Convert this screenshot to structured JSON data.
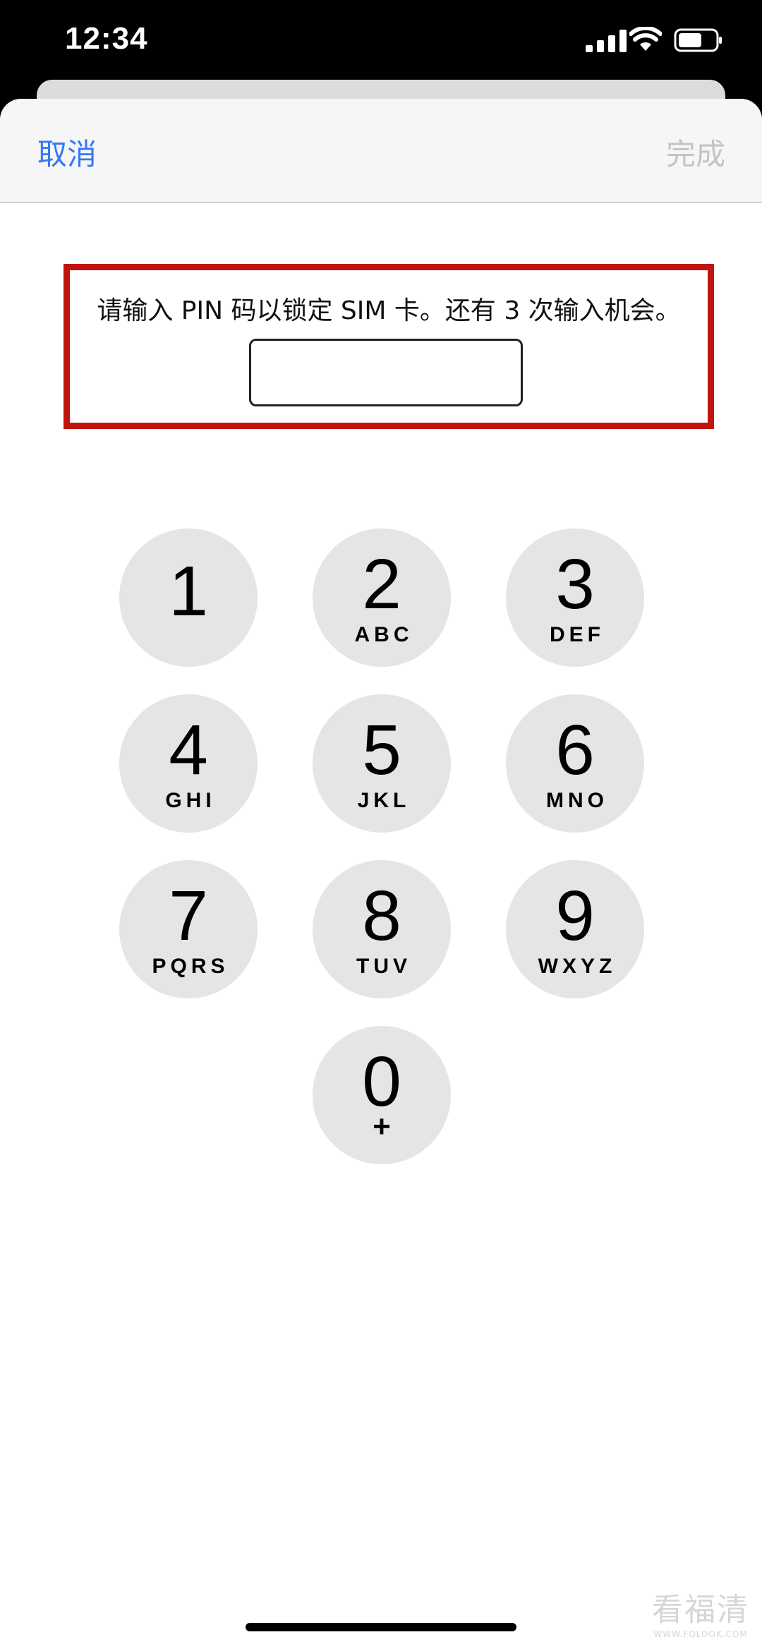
{
  "status_bar": {
    "time": "12:34"
  },
  "nav": {
    "cancel_label": "取消",
    "done_label": "完成"
  },
  "prompt": {
    "message": "请输入 PIN 码以锁定 SIM 卡。还有 3 次输入机会。",
    "highlight_color": "#c0150e"
  },
  "pin_input": {
    "value": ""
  },
  "keypad": {
    "keys": [
      {
        "digit": "1",
        "letters": ""
      },
      {
        "digit": "2",
        "letters": "ABC"
      },
      {
        "digit": "3",
        "letters": "DEF"
      },
      {
        "digit": "4",
        "letters": "GHI"
      },
      {
        "digit": "5",
        "letters": "JKL"
      },
      {
        "digit": "6",
        "letters": "MNO"
      },
      {
        "digit": "7",
        "letters": "PQRS"
      },
      {
        "digit": "8",
        "letters": "TUV"
      },
      {
        "digit": "9",
        "letters": "WXYZ"
      },
      {
        "digit": "0",
        "letters": "+"
      }
    ]
  },
  "watermark": {
    "main": "看福清",
    "sub": "WWW.FQLOOK.COM"
  },
  "colors": {
    "accent": "#3478f6",
    "disabled": "#c4c4c4",
    "key_bg": "#e5e5e5"
  }
}
